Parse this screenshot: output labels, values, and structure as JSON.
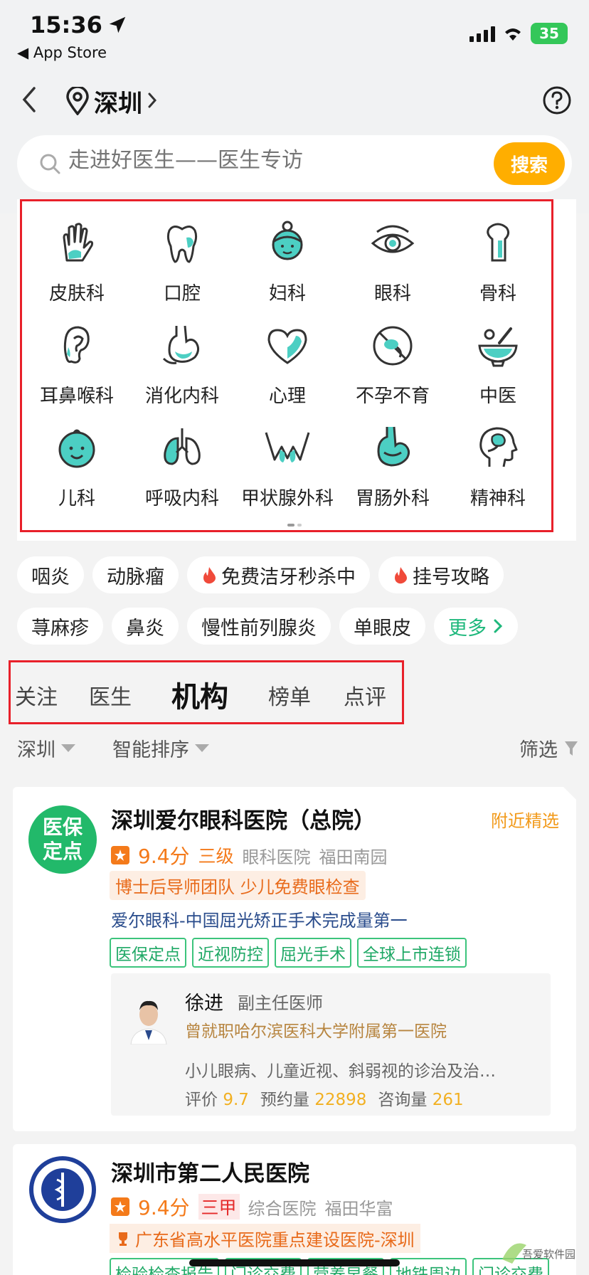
{
  "status_bar": {
    "time": "15:36",
    "back_app": "◀ App Store",
    "battery": "35"
  },
  "nav": {
    "city": "深圳"
  },
  "search": {
    "placeholder": "走进好医生——医生专访",
    "button": "搜索"
  },
  "departments": [
    "皮肤科",
    "口腔",
    "妇科",
    "眼科",
    "骨科",
    "耳鼻喉科",
    "消化内科",
    "心理",
    "不孕不育",
    "中医",
    "儿科",
    "呼吸内科",
    "甲状腺外科",
    "胃肠外科",
    "精神科"
  ],
  "tags": {
    "row1": [
      "咽炎",
      "动脉瘤",
      "免费洁牙秒杀中",
      "挂号攻略"
    ],
    "row2": [
      "荨麻疹",
      "鼻炎",
      "慢性前列腺炎",
      "单眼皮",
      "更多"
    ]
  },
  "tabs": [
    "关注",
    "医生",
    "机构",
    "榜单",
    "点评"
  ],
  "active_tab": "机构",
  "filters": {
    "city": "深圳",
    "sort": "智能排序",
    "filter": "筛选"
  },
  "hospitals": [
    {
      "logo_text": [
        "医保",
        "定点"
      ],
      "name": "深圳爱尔眼科医院（总院）",
      "nearby": "附近精选",
      "score": "9.4分",
      "level": "三级",
      "type": "眼科医院",
      "area": "福田南园",
      "promo": "博士后导师团队 少儿免费眼检查",
      "slogan": "爱尔眼科-中国屈光矫正手术完成量第一",
      "features": [
        "医保定点",
        "近视防控",
        "屈光手术",
        "全球上市连锁"
      ],
      "doctor": {
        "name": "徐进",
        "title": "副主任医师",
        "history": "曾就职哈尔滨医科大学附属第一医院",
        "specialty": "小儿眼病、儿童近视、斜弱视的诊治及治…",
        "rating_label": "评价",
        "rating": "9.7",
        "appoint_label": "预约量",
        "appoint": "22898",
        "consult_label": "咨询量",
        "consult": "261"
      }
    },
    {
      "name": "深圳市第二人民医院",
      "score": "9.4分",
      "level": "三甲",
      "type": "综合医院",
      "area": "福田华富",
      "badge": "广东省高水平医院重点建设医院-深圳",
      "features": [
        "检验检查报告",
        "门诊交费",
        "营养早餐",
        "地铁周边",
        "门诊交费"
      ]
    }
  ],
  "watermark": "吾爱软件园",
  "colors": {
    "accent": "#ffae00",
    "green": "#1eb87c",
    "teal": "#4ccfc3",
    "outline": "#e8202a"
  }
}
